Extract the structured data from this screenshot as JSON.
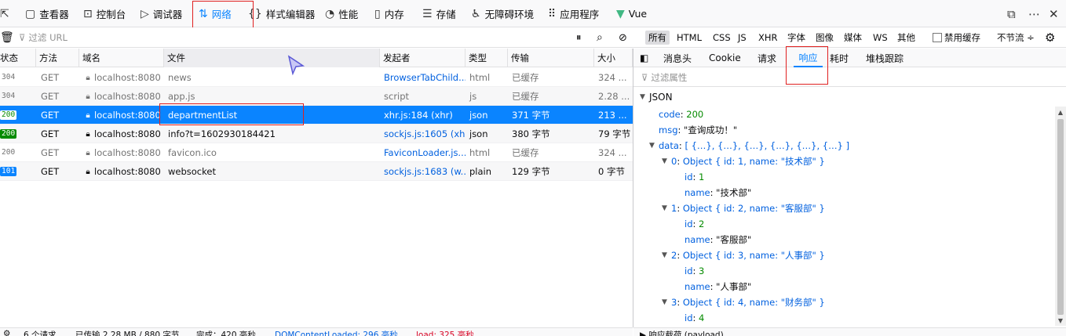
{
  "toolbar": {
    "tools": [
      {
        "label": "查看器",
        "icon": "inspector-icon"
      },
      {
        "label": "控制台",
        "icon": "console-icon"
      },
      {
        "label": "调试器",
        "icon": "debugger-icon"
      },
      {
        "label": "网络",
        "icon": "network-icon",
        "selected": true
      },
      {
        "label": "样式编辑器",
        "icon": "style-editor-icon"
      },
      {
        "label": "性能",
        "icon": "performance-icon"
      },
      {
        "label": "内存",
        "icon": "memory-icon"
      },
      {
        "label": "存储",
        "icon": "storage-icon"
      },
      {
        "label": "无障碍环境",
        "icon": "accessibility-icon"
      },
      {
        "label": "应用程序",
        "icon": "application-icon"
      },
      {
        "label": "Vue",
        "icon": "vue-icon"
      }
    ]
  },
  "filterbar": {
    "url_placeholder": "过滤 URL",
    "types": [
      "所有",
      "HTML",
      "CSS",
      "JS",
      "XHR",
      "字体",
      "图像",
      "媒体",
      "WS",
      "其他"
    ],
    "active_type": "所有",
    "disable_cache_label": "禁用缓存",
    "throttle_label": "不节流 ÷"
  },
  "table": {
    "headers": [
      "状态",
      "方法",
      "域名",
      "文件",
      "发起者",
      "类型",
      "传输",
      "大小"
    ],
    "rows": [
      {
        "status": "304",
        "method": "GET",
        "domain": "localhost:8080",
        "file": "news",
        "initiator": "BrowserTabChild...",
        "type": "html",
        "transfer": "已缓存",
        "size": "324 ..."
      },
      {
        "status": "304",
        "method": "GET",
        "domain": "localhost:8080",
        "file": "app.js",
        "initiator": "script",
        "type": "js",
        "transfer": "已缓存",
        "size": "2.28 ..."
      },
      {
        "status": "200",
        "method": "GET",
        "domain": "localhost:8080",
        "file": "departmentList",
        "initiator": "xhr.js:184 (xhr)",
        "type": "json",
        "transfer": "371 字节",
        "size": "213 ..."
      },
      {
        "status": "200",
        "method": "GET",
        "domain": "localhost:8080",
        "file": "info?t=1602930184421",
        "initiator": "sockjs.js:1605 (xhr)",
        "type": "json",
        "transfer": "380 字节",
        "size": "79 字节"
      },
      {
        "status": "200",
        "method": "GET",
        "domain": "localhost:8080",
        "file": "favicon.ico",
        "initiator": "FaviconLoader.js...",
        "type": "html",
        "transfer": "已缓存",
        "size": "324 ..."
      },
      {
        "status": "101",
        "method": "GET",
        "domain": "localhost:8080",
        "file": "websocket",
        "initiator": "sockjs.js:1683 (w...",
        "type": "plain",
        "transfer": "129 字节",
        "size": "0 字节"
      }
    ]
  },
  "details": {
    "tabs": [
      "消息头",
      "Cookie",
      "请求",
      "响应",
      "耗时",
      "堆栈跟踪"
    ],
    "active_tab": "响应",
    "filter_placeholder": "过滤属性",
    "json_label": "JSON",
    "tree": [
      {
        "indent": 0,
        "twisty": "",
        "key": "code",
        "value": "200",
        "vtype": "num"
      },
      {
        "indent": 0,
        "twisty": "",
        "key": "msg",
        "value": "\"查询成功！\"",
        "vtype": "str"
      },
      {
        "indent": 0,
        "twisty": "▼",
        "key": "data",
        "value": "[ {…}, {…}, {…}, {…}, {…}, {…} ]",
        "vtype": "obj"
      },
      {
        "indent": 1,
        "twisty": "▼",
        "key": "0",
        "value": "Object { id: 1, name: \"技术部\" }",
        "vtype": "obj"
      },
      {
        "indent": 2,
        "twisty": "",
        "key": "id",
        "value": "1",
        "vtype": "num"
      },
      {
        "indent": 2,
        "twisty": "",
        "key": "name",
        "value": "\"技术部\"",
        "vtype": "str"
      },
      {
        "indent": 1,
        "twisty": "▼",
        "key": "1",
        "value": "Object { id: 2, name: \"客服部\" }",
        "vtype": "obj"
      },
      {
        "indent": 2,
        "twisty": "",
        "key": "id",
        "value": "2",
        "vtype": "num"
      },
      {
        "indent": 2,
        "twisty": "",
        "key": "name",
        "value": "\"客服部\"",
        "vtype": "str"
      },
      {
        "indent": 1,
        "twisty": "▼",
        "key": "2",
        "value": "Object { id: 3, name: \"人事部\" }",
        "vtype": "obj"
      },
      {
        "indent": 2,
        "twisty": "",
        "key": "id",
        "value": "3",
        "vtype": "num"
      },
      {
        "indent": 2,
        "twisty": "",
        "key": "name",
        "value": "\"人事部\"",
        "vtype": "str"
      },
      {
        "indent": 1,
        "twisty": "▼",
        "key": "3",
        "value": "Object { id: 4, name: \"财务部\" }",
        "vtype": "obj"
      },
      {
        "indent": 2,
        "twisty": "",
        "key": "id",
        "value": "4",
        "vtype": "num"
      }
    ],
    "bottom_label": "▶ 响应载荷 (payload)"
  },
  "statusbar": {
    "requests": "6 个请求",
    "transferred": "已传输 2.28 MB / 880 字节",
    "finish": "完成：420 毫秒",
    "dom": "DOMContentLoaded: 296 毫秒",
    "load": "load: 325 毫秒"
  },
  "colors": {
    "accent": "#0a84ff",
    "selected_row": "#0a84ff",
    "status_200": "#058b00",
    "highlight_box": "#e02020"
  }
}
